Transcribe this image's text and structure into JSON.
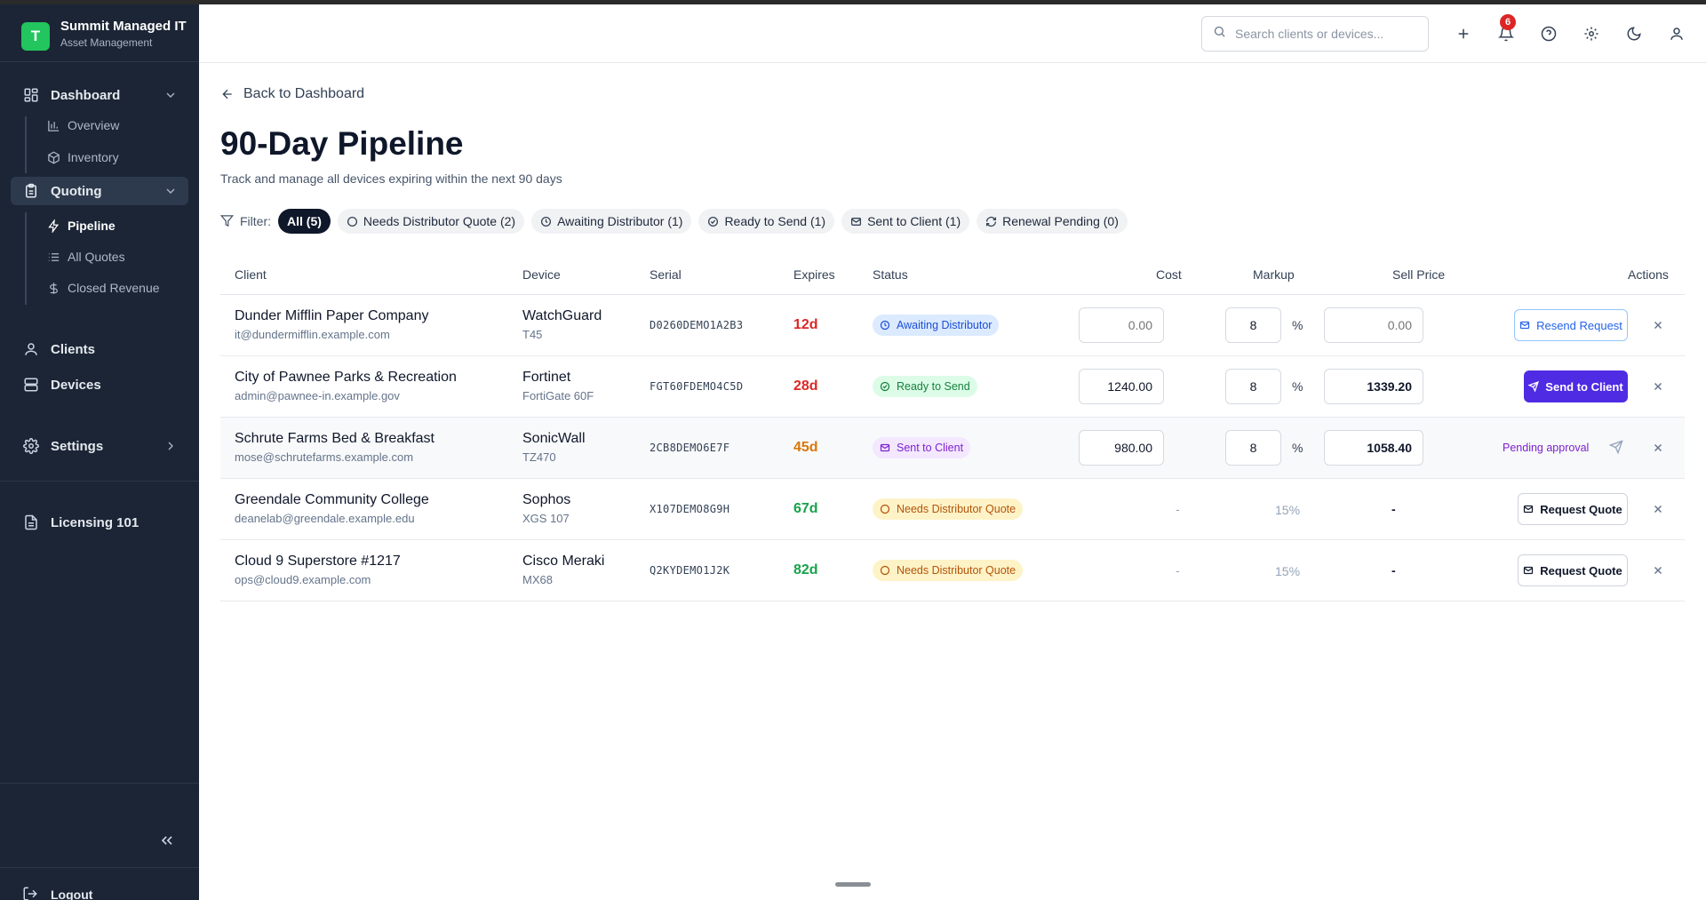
{
  "app": {
    "logo_letter": "T",
    "name": "Summit Managed IT",
    "subtitle": "Asset Management"
  },
  "sidebar": {
    "dashboard": {
      "label": "Dashboard",
      "items": [
        {
          "label": "Overview",
          "icon": "bar-chart-icon"
        },
        {
          "label": "Inventory",
          "icon": "package-icon"
        }
      ]
    },
    "quoting": {
      "label": "Quoting",
      "items": [
        {
          "label": "Pipeline",
          "icon": "zap-icon",
          "active": true
        },
        {
          "label": "All Quotes",
          "icon": "list-icon"
        },
        {
          "label": "Closed Revenue",
          "icon": "dollar-icon"
        }
      ]
    },
    "clients": "Clients",
    "devices": "Devices",
    "settings": "Settings",
    "licensing": "Licensing 101",
    "logout": "Logout"
  },
  "topbar": {
    "search_placeholder": "Search clients or devices...",
    "notification_count": "6"
  },
  "page": {
    "back_label": "Back to Dashboard",
    "title": "90-Day Pipeline",
    "subtitle": "Track and manage all devices expiring within the next 90 days"
  },
  "filters": {
    "label": "Filter:",
    "chips": [
      {
        "label": "All (5)",
        "active": true
      },
      {
        "label": "Needs Distributor Quote (2)",
        "icon": "circle-icon"
      },
      {
        "label": "Awaiting Distributor (1)",
        "icon": "clock-icon"
      },
      {
        "label": "Ready to Send (1)",
        "icon": "check-circle-icon"
      },
      {
        "label": "Sent to Client (1)",
        "icon": "mail-icon"
      },
      {
        "label": "Renewal Pending (0)",
        "icon": "refresh-icon"
      }
    ]
  },
  "table": {
    "headers": {
      "client": "Client",
      "device": "Device",
      "serial": "Serial",
      "expires": "Expires",
      "status": "Status",
      "cost": "Cost",
      "markup": "Markup",
      "sell_price": "Sell Price",
      "actions": "Actions"
    },
    "percent_sign": "%",
    "rows": [
      {
        "client": "Dunder Mifflin Paper Company",
        "email": "it@dundermifflin.example.com",
        "vendor": "WatchGuard",
        "model": "T45",
        "serial": "D0260DEMO1A2B3",
        "expires": "12d",
        "expires_color": "#dc2626",
        "status": "Awaiting Distributor",
        "cost": "",
        "cost_placeholder": "0.00",
        "markup": "8",
        "sell": "",
        "sell_placeholder": "0.00",
        "action": "Resend Request"
      },
      {
        "client": "City of Pawnee Parks & Recreation",
        "email": "admin@pawnee-in.example.gov",
        "vendor": "Fortinet",
        "model": "FortiGate 60F",
        "serial": "FGT60FDEMO4C5D",
        "expires": "28d",
        "expires_color": "#dc2626",
        "status": "Ready to Send",
        "cost": "1240.00",
        "markup": "8",
        "sell": "1339.20",
        "action": "Send to Client"
      },
      {
        "client": "Schrute Farms Bed & Breakfast",
        "email": "mose@schrutefarms.example.com",
        "vendor": "SonicWall",
        "model": "TZ470",
        "serial": "2CB8DEMO6E7F",
        "expires": "45d",
        "expires_color": "#d97706",
        "status": "Sent to Client",
        "cost": "980.00",
        "markup": "8",
        "sell": "1058.40",
        "action": "Pending approval"
      },
      {
        "client": "Greendale Community College",
        "email": "deanelab@greendale.example.edu",
        "vendor": "Sophos",
        "model": "XGS 107",
        "serial": "X107DEMO8G9H",
        "expires": "67d",
        "expires_color": "#16a34a",
        "status": "Needs Distributor Quote",
        "cost": "-",
        "markup": "15%",
        "sell": "-",
        "action": "Request Quote"
      },
      {
        "client": "Cloud 9 Superstore #1217",
        "email": "ops@cloud9.example.com",
        "vendor": "Cisco Meraki",
        "model": "MX68",
        "serial": "Q2KYDEMO1J2K",
        "expires": "82d",
        "expires_color": "#16a34a",
        "status": "Needs Distributor Quote",
        "cost": "-",
        "markup": "15%",
        "sell": "-",
        "action": "Request Quote"
      }
    ]
  }
}
